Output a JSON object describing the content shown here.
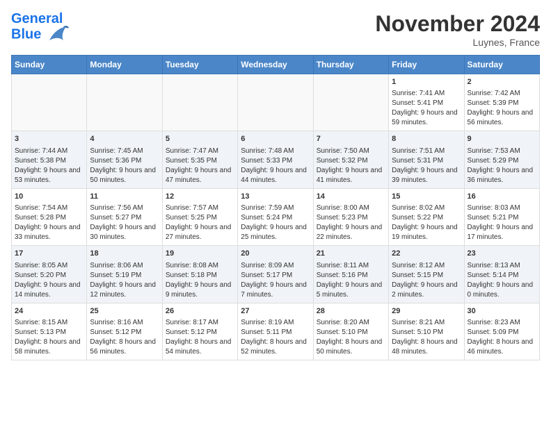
{
  "header": {
    "logo_line1": "General",
    "logo_line2": "Blue",
    "month": "November 2024",
    "location": "Luynes, France"
  },
  "days_of_week": [
    "Sunday",
    "Monday",
    "Tuesday",
    "Wednesday",
    "Thursday",
    "Friday",
    "Saturday"
  ],
  "weeks": [
    [
      {
        "day": "",
        "content": ""
      },
      {
        "day": "",
        "content": ""
      },
      {
        "day": "",
        "content": ""
      },
      {
        "day": "",
        "content": ""
      },
      {
        "day": "",
        "content": ""
      },
      {
        "day": "1",
        "content": "Sunrise: 7:41 AM\nSunset: 5:41 PM\nDaylight: 9 hours and 59 minutes."
      },
      {
        "day": "2",
        "content": "Sunrise: 7:42 AM\nSunset: 5:39 PM\nDaylight: 9 hours and 56 minutes."
      }
    ],
    [
      {
        "day": "3",
        "content": "Sunrise: 7:44 AM\nSunset: 5:38 PM\nDaylight: 9 hours and 53 minutes."
      },
      {
        "day": "4",
        "content": "Sunrise: 7:45 AM\nSunset: 5:36 PM\nDaylight: 9 hours and 50 minutes."
      },
      {
        "day": "5",
        "content": "Sunrise: 7:47 AM\nSunset: 5:35 PM\nDaylight: 9 hours and 47 minutes."
      },
      {
        "day": "6",
        "content": "Sunrise: 7:48 AM\nSunset: 5:33 PM\nDaylight: 9 hours and 44 minutes."
      },
      {
        "day": "7",
        "content": "Sunrise: 7:50 AM\nSunset: 5:32 PM\nDaylight: 9 hours and 41 minutes."
      },
      {
        "day": "8",
        "content": "Sunrise: 7:51 AM\nSunset: 5:31 PM\nDaylight: 9 hours and 39 minutes."
      },
      {
        "day": "9",
        "content": "Sunrise: 7:53 AM\nSunset: 5:29 PM\nDaylight: 9 hours and 36 minutes."
      }
    ],
    [
      {
        "day": "10",
        "content": "Sunrise: 7:54 AM\nSunset: 5:28 PM\nDaylight: 9 hours and 33 minutes."
      },
      {
        "day": "11",
        "content": "Sunrise: 7:56 AM\nSunset: 5:27 PM\nDaylight: 9 hours and 30 minutes."
      },
      {
        "day": "12",
        "content": "Sunrise: 7:57 AM\nSunset: 5:25 PM\nDaylight: 9 hours and 27 minutes."
      },
      {
        "day": "13",
        "content": "Sunrise: 7:59 AM\nSunset: 5:24 PM\nDaylight: 9 hours and 25 minutes."
      },
      {
        "day": "14",
        "content": "Sunrise: 8:00 AM\nSunset: 5:23 PM\nDaylight: 9 hours and 22 minutes."
      },
      {
        "day": "15",
        "content": "Sunrise: 8:02 AM\nSunset: 5:22 PM\nDaylight: 9 hours and 19 minutes."
      },
      {
        "day": "16",
        "content": "Sunrise: 8:03 AM\nSunset: 5:21 PM\nDaylight: 9 hours and 17 minutes."
      }
    ],
    [
      {
        "day": "17",
        "content": "Sunrise: 8:05 AM\nSunset: 5:20 PM\nDaylight: 9 hours and 14 minutes."
      },
      {
        "day": "18",
        "content": "Sunrise: 8:06 AM\nSunset: 5:19 PM\nDaylight: 9 hours and 12 minutes."
      },
      {
        "day": "19",
        "content": "Sunrise: 8:08 AM\nSunset: 5:18 PM\nDaylight: 9 hours and 9 minutes."
      },
      {
        "day": "20",
        "content": "Sunrise: 8:09 AM\nSunset: 5:17 PM\nDaylight: 9 hours and 7 minutes."
      },
      {
        "day": "21",
        "content": "Sunrise: 8:11 AM\nSunset: 5:16 PM\nDaylight: 9 hours and 5 minutes."
      },
      {
        "day": "22",
        "content": "Sunrise: 8:12 AM\nSunset: 5:15 PM\nDaylight: 9 hours and 2 minutes."
      },
      {
        "day": "23",
        "content": "Sunrise: 8:13 AM\nSunset: 5:14 PM\nDaylight: 9 hours and 0 minutes."
      }
    ],
    [
      {
        "day": "24",
        "content": "Sunrise: 8:15 AM\nSunset: 5:13 PM\nDaylight: 8 hours and 58 minutes."
      },
      {
        "day": "25",
        "content": "Sunrise: 8:16 AM\nSunset: 5:12 PM\nDaylight: 8 hours and 56 minutes."
      },
      {
        "day": "26",
        "content": "Sunrise: 8:17 AM\nSunset: 5:12 PM\nDaylight: 8 hours and 54 minutes."
      },
      {
        "day": "27",
        "content": "Sunrise: 8:19 AM\nSunset: 5:11 PM\nDaylight: 8 hours and 52 minutes."
      },
      {
        "day": "28",
        "content": "Sunrise: 8:20 AM\nSunset: 5:10 PM\nDaylight: 8 hours and 50 minutes."
      },
      {
        "day": "29",
        "content": "Sunrise: 8:21 AM\nSunset: 5:10 PM\nDaylight: 8 hours and 48 minutes."
      },
      {
        "day": "30",
        "content": "Sunrise: 8:23 AM\nSunset: 5:09 PM\nDaylight: 8 hours and 46 minutes."
      }
    ]
  ]
}
